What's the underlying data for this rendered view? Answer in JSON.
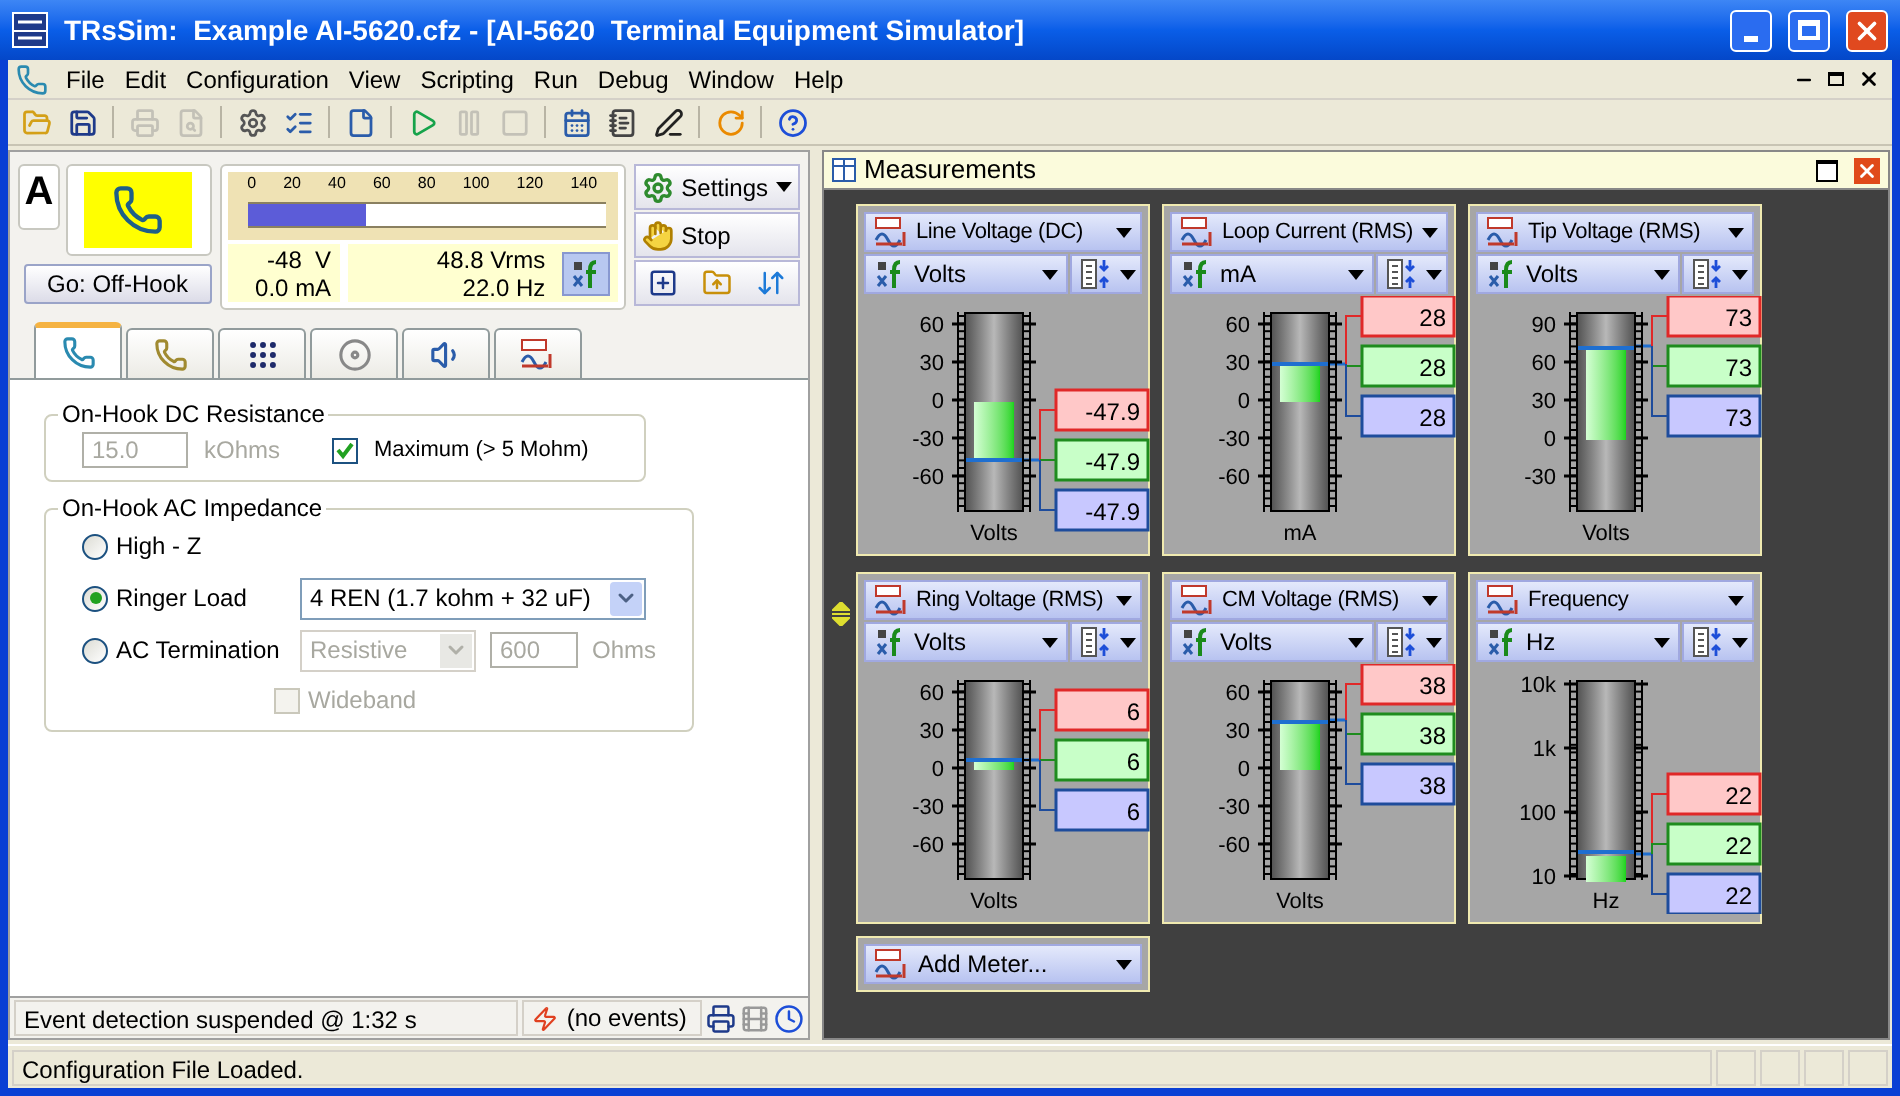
{
  "window": {
    "title": "TRsSim:  Example AI-5620.cfz - [AI-5620  Terminal Equipment Simulator]"
  },
  "menu": [
    "File",
    "Edit",
    "Configuration",
    "View",
    "Scripting",
    "Run",
    "Debug",
    "Window",
    "Help"
  ],
  "toolbar": [
    {
      "disabled": false
    },
    {
      "disabled": false
    },
    {
      "disabled": true
    },
    {
      "disabled": true
    },
    {
      "disabled": false
    },
    {
      "disabled": false
    },
    {
      "disabled": false
    },
    {
      "disabled": false
    },
    {
      "disabled": true
    },
    {
      "disabled": true
    },
    {
      "disabled": false
    },
    {
      "disabled": false
    },
    {
      "disabled": false
    },
    {
      "disabled": false
    },
    {
      "disabled": false
    }
  ],
  "channel_badge": "A",
  "off_hook_button": "Go: Off-Hook",
  "scale": {
    "ticks": [
      "0",
      "20",
      "40",
      "60",
      "80",
      "100",
      "120",
      "140"
    ],
    "level": 0.33
  },
  "readouts": [
    "-48  V",
    "0.0 mA",
    "48.8 Vrms",
    "22.0 Hz"
  ],
  "settings_button": "Settings",
  "stop_button": "Stop",
  "tabs": [
    {
      "selected": true
    },
    {
      "selected": false
    },
    {
      "selected": false
    },
    {
      "selected": false
    },
    {
      "selected": false
    },
    {
      "selected": false
    }
  ],
  "dc_resistance": {
    "title": "On-Hook DC Resistance",
    "value": "15.0",
    "unit": "kOhms",
    "disabled": true,
    "maximum": {
      "label": "Maximum (> 5 Mohm)",
      "checked": true
    }
  },
  "ac_impedance": {
    "title": "On-Hook AC Impedance",
    "options": [
      {
        "label": "High - Z",
        "selected": false
      },
      {
        "label": "Ringer Load",
        "selected": true
      },
      {
        "label": "AC Termination",
        "selected": false
      }
    ],
    "ringer_load": "4 REN (1.7 kohm + 32 uF)",
    "termination_type": {
      "value": "Resistive",
      "disabled": true
    },
    "termination_ohms": {
      "value": "600",
      "unit": "Ohms",
      "disabled": true
    },
    "wideband": {
      "label": "Wideband",
      "checked": false,
      "disabled": true
    }
  },
  "event_status": "Event detection suspended @ 1:32 s",
  "events": "(no events)",
  "measurements": {
    "title": "Measurements",
    "add_meter": "Add Meter...",
    "meters": [
      {
        "title": "Line Voltage (DC)",
        "unit": "Volts",
        "kind": "linear",
        "ticks": [
          "60",
          "30",
          "0",
          "-30",
          "-60"
        ],
        "level": 0.26,
        "axis_label": "Volts",
        "readings": [
          {
            "value": "-47.9",
            "color": "#e02828"
          },
          {
            "value": "-47.9",
            "color": "#1e8c1e"
          },
          {
            "value": "-47.9",
            "color": "#1e4c9c"
          }
        ]
      },
      {
        "title": "Loop Current (RMS)",
        "unit": "mA",
        "kind": "linear",
        "ticks": [
          "60",
          "30",
          "0",
          "-30",
          "-60"
        ],
        "level": 0.74,
        "axis_label": "mA",
        "readings": [
          {
            "value": "28",
            "color": "#e02828"
          },
          {
            "value": "28",
            "color": "#1e8c1e"
          },
          {
            "value": "28",
            "color": "#1e4c9c"
          }
        ]
      },
      {
        "title": "Tip Voltage (RMS)",
        "unit": "Volts",
        "kind": "linear",
        "ticks": [
          "90",
          "60",
          "30",
          "0",
          "-30"
        ],
        "level": 0.83,
        "axis_label": "Volts",
        "readings": [
          {
            "value": "73",
            "color": "#e02828"
          },
          {
            "value": "73",
            "color": "#1e8c1e"
          },
          {
            "value": "73",
            "color": "#1e4c9c"
          }
        ]
      },
      {
        "title": "Ring Voltage (RMS)",
        "unit": "Volts",
        "kind": "linear",
        "ticks": [
          "60",
          "30",
          "0",
          "-30",
          "-60"
        ],
        "level": 0.6,
        "axis_label": "Volts",
        "readings": [
          {
            "value": "6",
            "color": "#e02828"
          },
          {
            "value": "6",
            "color": "#1e8c1e"
          },
          {
            "value": "6",
            "color": "#1e4c9c"
          }
        ]
      },
      {
        "title": "CM Voltage (RMS)",
        "unit": "Volts",
        "kind": "linear",
        "ticks": [
          "60",
          "30",
          "0",
          "-30",
          "-60"
        ],
        "level": 0.8,
        "axis_label": "Volts",
        "readings": [
          {
            "value": "38",
            "color": "#e02828"
          },
          {
            "value": "38",
            "color": "#1e8c1e"
          },
          {
            "value": "38",
            "color": "#1e4c9c"
          }
        ]
      },
      {
        "title": "Frequency",
        "unit": "Hz",
        "kind": "log",
        "ticks": [
          "10k",
          "1k",
          "100",
          "10"
        ],
        "level": 0.13,
        "axis_label": "Hz",
        "readings": [
          {
            "value": "22",
            "color": "#e02828"
          },
          {
            "value": "22",
            "color": "#1e8c1e"
          },
          {
            "value": "22",
            "color": "#1e4c9c"
          }
        ]
      }
    ]
  },
  "status_bar": {
    "text": "Configuration File Loaded."
  }
}
